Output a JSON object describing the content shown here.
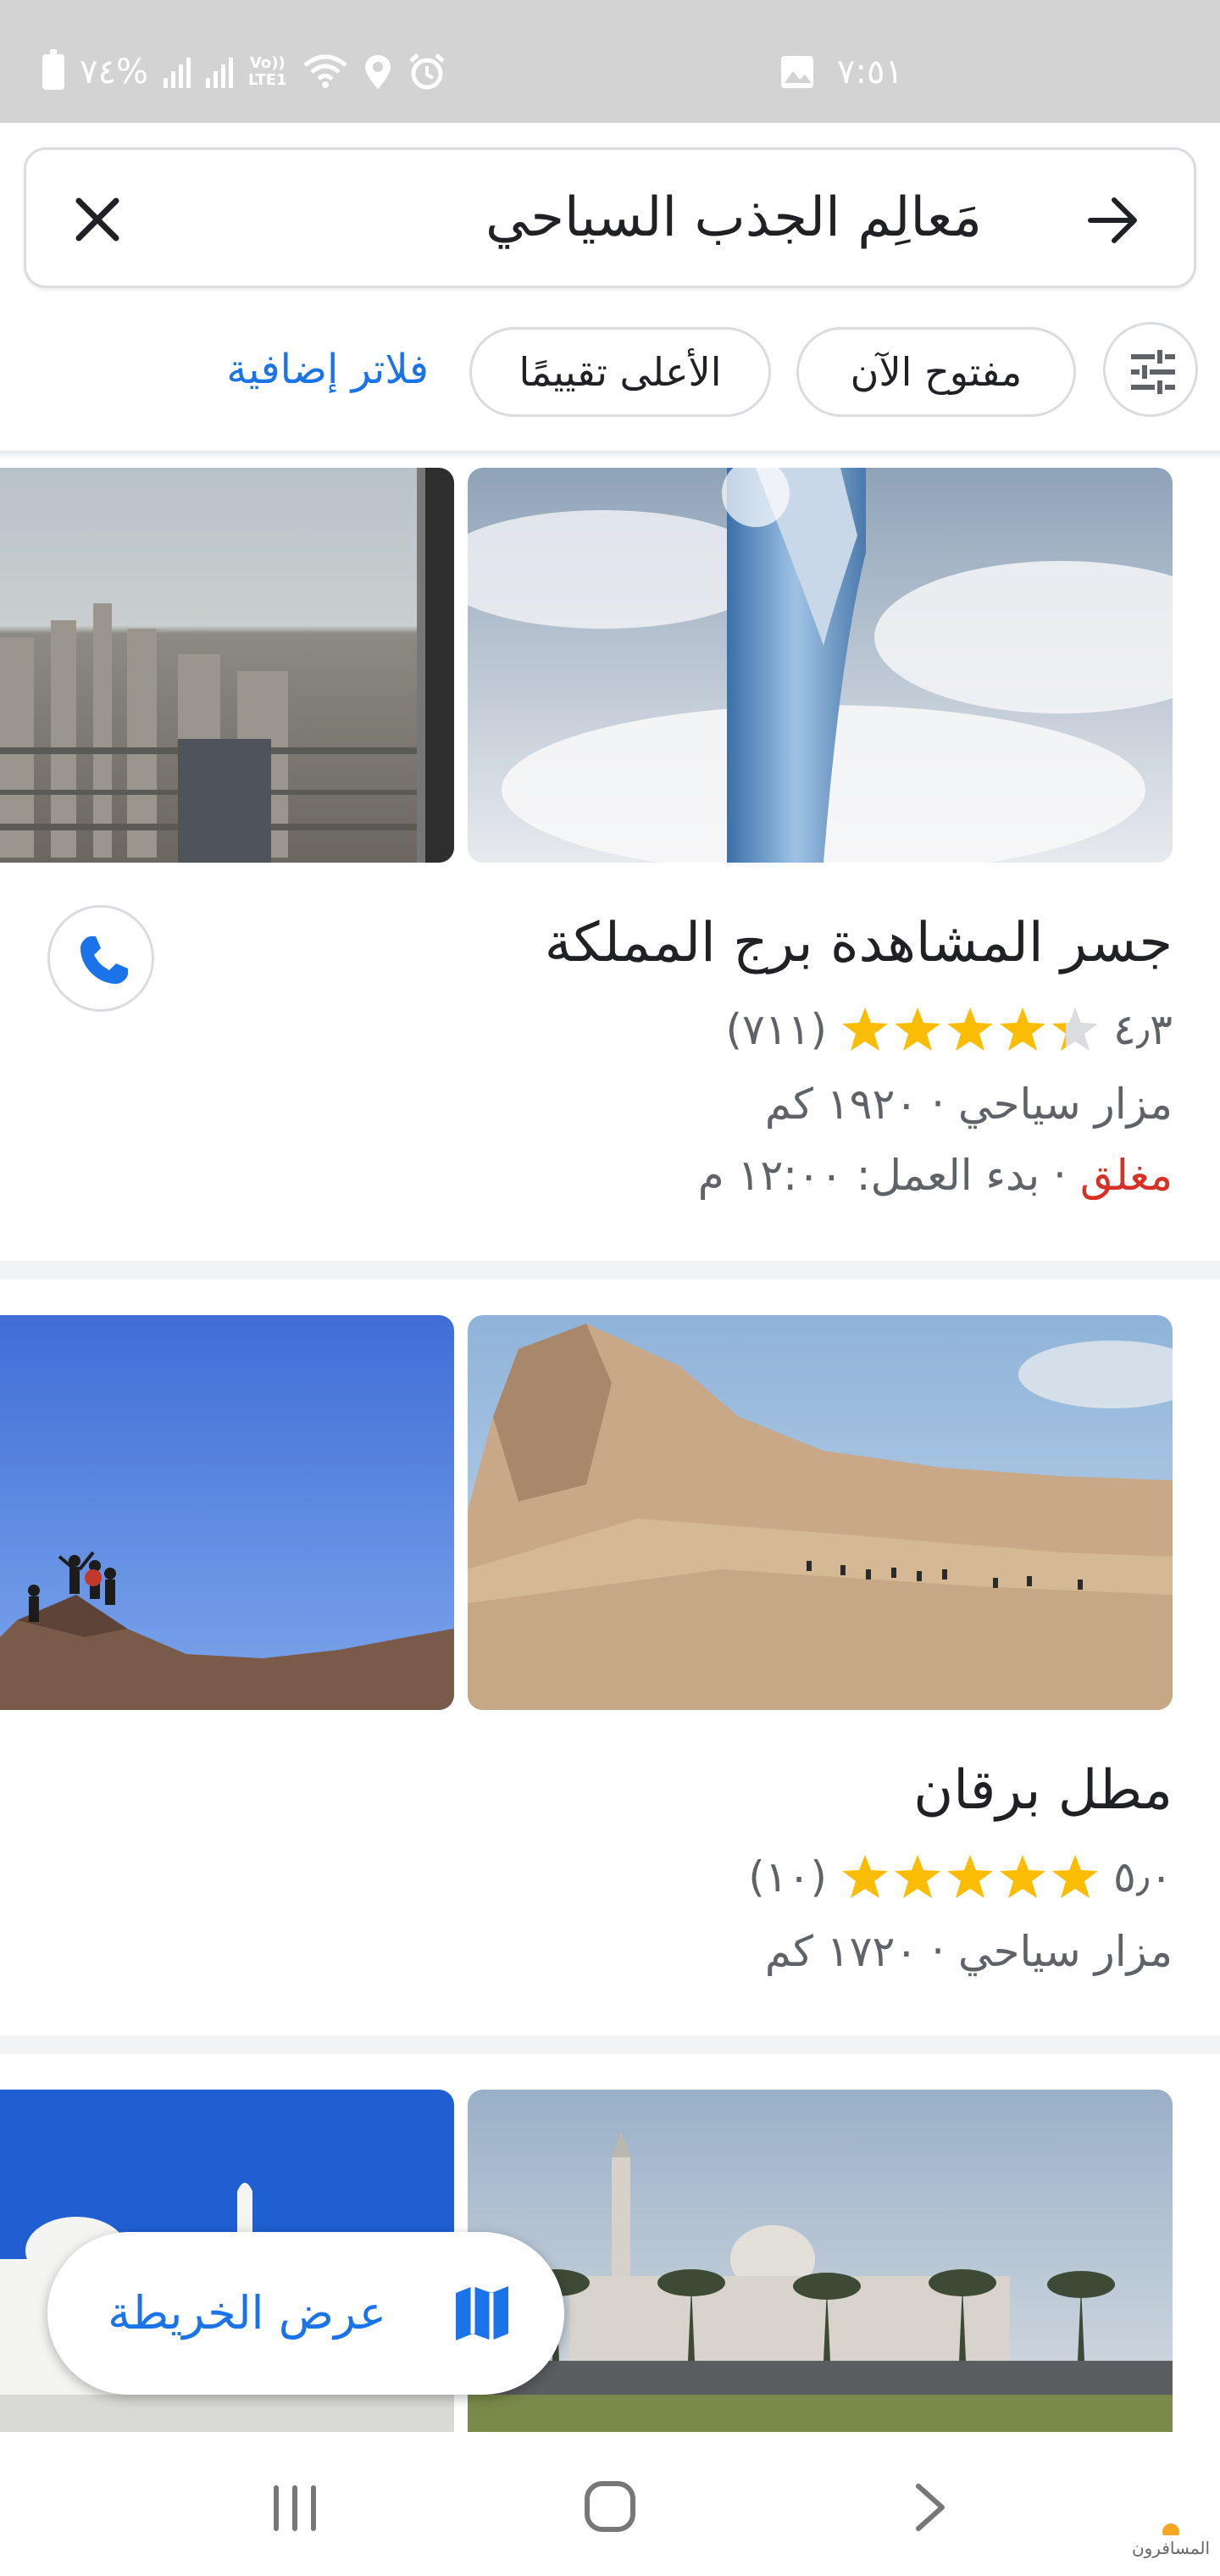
{
  "status_bar": {
    "battery": "٧٤%",
    "network": "Vo))",
    "network_sub": "LTE1",
    "time": "٧:٥١"
  },
  "search": {
    "query": "مَعالِم الجذب السياحي"
  },
  "filters": {
    "open_now": "مفتوح الآن",
    "top_rated": "الأعلى تقييمًا",
    "more_filters": "فلاتر إضافية"
  },
  "results": [
    {
      "name": "جسر المشاهدة برج المملكة",
      "rating": "٤٫٣",
      "rating_value": 4.3,
      "reviews": "(٧١١)",
      "category_distance": "مزار سياحي · ١٩٢٠ كم",
      "status": "مغلق",
      "hours": " · بدء العمل: ١٢:٠٠ م"
    },
    {
      "name": "مطل برقان",
      "rating": "٥٫٠",
      "rating_value": 5.0,
      "reviews": "(١٠)",
      "category_distance": "مزار سياحي · ١٧٢٠ كم"
    }
  ],
  "map_button": {
    "label": "عرض الخريطة"
  },
  "colors": {
    "accent": "#1a73e8",
    "star": "#fbbc04",
    "closed": "#d93025",
    "status_bar": "#d3d3d3"
  },
  "icons": [
    "battery-icon",
    "signal-icon",
    "wifi-icon",
    "location-icon",
    "alarm-icon",
    "image-icon",
    "back-arrow-icon",
    "close-icon",
    "tune-icon",
    "star-icon",
    "phone-icon",
    "map-icon",
    "recents-icon",
    "home-icon",
    "back-nav-icon"
  ],
  "watermark": "المسافرون"
}
